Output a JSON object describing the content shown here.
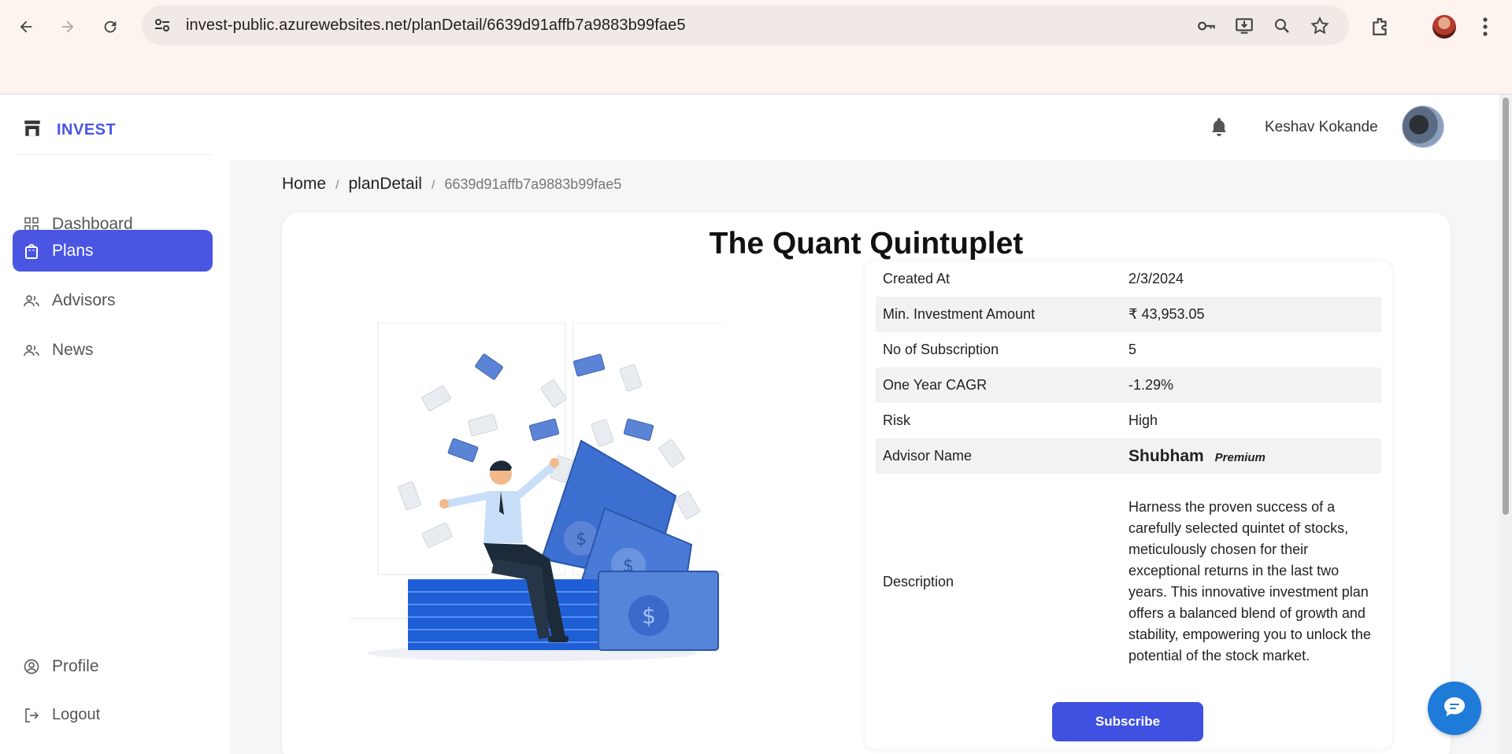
{
  "browser": {
    "url": "invest-public.azurewebsites.net/planDetail/6639d91affb7a9883b99fae5"
  },
  "sidebar": {
    "logo": "INVEST",
    "items": [
      {
        "label": "Dashboard",
        "icon": "grid-icon",
        "active": false
      },
      {
        "label": "Plans",
        "icon": "bag-icon",
        "active": true
      },
      {
        "label": "Advisors",
        "icon": "people-icon",
        "active": false
      },
      {
        "label": "News",
        "icon": "people-icon",
        "active": false
      }
    ],
    "bottom_items": [
      {
        "label": "Profile",
        "icon": "user-circle-icon"
      },
      {
        "label": "Logout",
        "icon": "logout-icon"
      }
    ]
  },
  "header": {
    "username": "Keshav Kokande"
  },
  "breadcrumb": {
    "home": "Home",
    "section": "planDetail",
    "current": "6639d91affb7a9883b99fae5"
  },
  "plan": {
    "title": "The Quant Quintuplet",
    "rows": [
      {
        "key": "Created At",
        "value": "2/3/2024"
      },
      {
        "key": "Min. Investment Amount",
        "value": "₹ 43,953.05"
      },
      {
        "key": "No of Subscription",
        "value": "5"
      },
      {
        "key": "One Year CAGR",
        "value": "-1.29%"
      },
      {
        "key": "Risk",
        "value": "High"
      }
    ],
    "advisor": {
      "key": "Advisor Name",
      "name": "Shubham",
      "badge": "Premium"
    },
    "description": {
      "key": "Description",
      "value": "Harness the proven success of a carefully selected quintet of stocks, meticulously chosen for their exceptional returns in the last two years. This innovative investment plan offers a balanced blend of growth and stability, empowering you to unlock the potential of the stock market."
    },
    "subscribe_label": "Subscribe"
  },
  "colors": {
    "accent": "#4a56e2",
    "button": "#3f51e0",
    "chat": "#1f7bd8"
  }
}
